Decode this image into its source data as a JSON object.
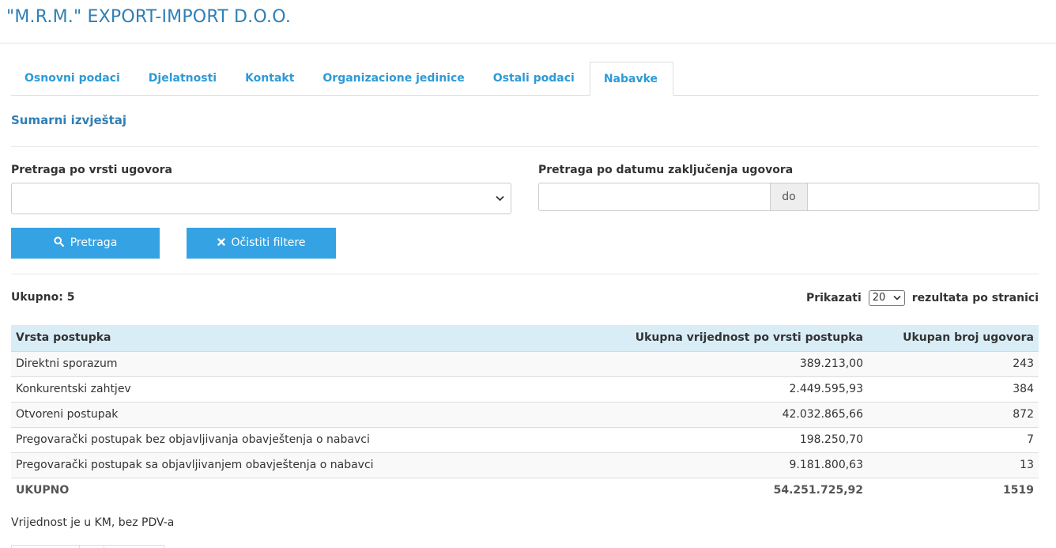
{
  "header": {
    "company_name": "\"M.R.M.\" EXPORT-IMPORT D.O.O."
  },
  "tabs": [
    {
      "label": "Osnovni podaci",
      "active": false
    },
    {
      "label": "Djelatnosti",
      "active": false
    },
    {
      "label": "Kontakt",
      "active": false
    },
    {
      "label": "Organizacione jedinice",
      "active": false
    },
    {
      "label": "Ostali podaci",
      "active": false
    },
    {
      "label": "Nabavke",
      "active": true
    }
  ],
  "section_title": "Sumarni izvještaj",
  "filters": {
    "contract_type_label": "Pretraga po vrsti ugovora",
    "contract_type_value": "",
    "date_label": "Pretraga po datumu zaključenja ugovora",
    "date_from": "",
    "date_separator": "do",
    "date_to": ""
  },
  "buttons": {
    "search_label": "Pretraga",
    "clear_label": "Očistiti filtere"
  },
  "results": {
    "total_text": "Ukupno: 5",
    "show_label": "Prikazati",
    "page_size": "20",
    "per_page_label": "rezultata po stranici"
  },
  "table": {
    "columns": [
      "Vrsta postupka",
      "Ukupna vrijednost po vrsti postupka",
      "Ukupan broj ugovora"
    ],
    "rows": [
      {
        "type": "Direktni sporazum",
        "value": "389.213,00",
        "count": "243"
      },
      {
        "type": "Konkurentski zahtjev",
        "value": "2.449.595,93",
        "count": "384"
      },
      {
        "type": "Otvoreni postupak",
        "value": "42.032.865,66",
        "count": "872"
      },
      {
        "type": "Pregovarački postupak bez objavljivanja obavještenja o nabavci",
        "value": "198.250,70",
        "count": "7"
      },
      {
        "type": "Pregovarački postupak sa objavljivanjem obavještenja o nabavci",
        "value": "9.181.800,63",
        "count": "13"
      }
    ],
    "total": {
      "label": "UKUPNO",
      "value": "54.251.725,92",
      "count": "1519"
    }
  },
  "note": "Vrijednost je u KM, bez PDV-a",
  "colors": {
    "accent": "#35a3e3",
    "title": "#2f7fb5",
    "table_header": "#d9edf7"
  }
}
